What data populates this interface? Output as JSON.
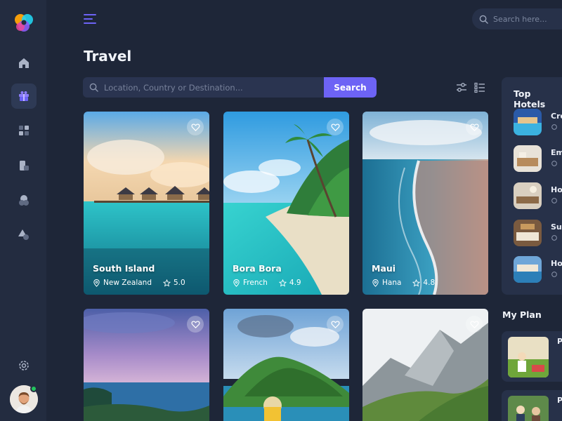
{
  "page": {
    "title": "Travel"
  },
  "top_search": {
    "placeholder": "Search here..."
  },
  "search": {
    "placeholder": "Location, Country or Destination...",
    "button_label": "Search"
  },
  "sidebar": {
    "items": [
      {
        "icon": "home-icon",
        "active": false
      },
      {
        "icon": "gift-icon",
        "active": true
      },
      {
        "icon": "grid-icon",
        "active": false
      },
      {
        "icon": "document-icon",
        "active": false
      },
      {
        "icon": "users-icon",
        "active": false
      },
      {
        "icon": "shapes-icon",
        "active": false
      },
      {
        "icon": "gear-icon",
        "active": false
      }
    ]
  },
  "destinations": [
    {
      "name": "South Island",
      "location": "New Zealand",
      "rating": "5.0"
    },
    {
      "name": "Bora Bora",
      "location": "French",
      "rating": "4.9"
    },
    {
      "name": "Maui",
      "location": "Hana",
      "rating": "4.8"
    },
    {
      "name": "",
      "location": "",
      "rating": ""
    },
    {
      "name": "",
      "location": "",
      "rating": ""
    },
    {
      "name": "",
      "location": "",
      "rating": ""
    }
  ],
  "top_hotels": {
    "title": "Top Hotels",
    "items": [
      {
        "name": "Cro"
      },
      {
        "name": "Em"
      },
      {
        "name": "Ho"
      },
      {
        "name": "Sur"
      },
      {
        "name": "Ho"
      }
    ]
  },
  "my_plan": {
    "title": "My Plan",
    "items": [
      {
        "name": "P"
      },
      {
        "name": "P"
      }
    ]
  },
  "colors": {
    "accent": "#6d63f5",
    "background": "#1e2638",
    "panel": "#273149",
    "online": "#22c55e"
  }
}
